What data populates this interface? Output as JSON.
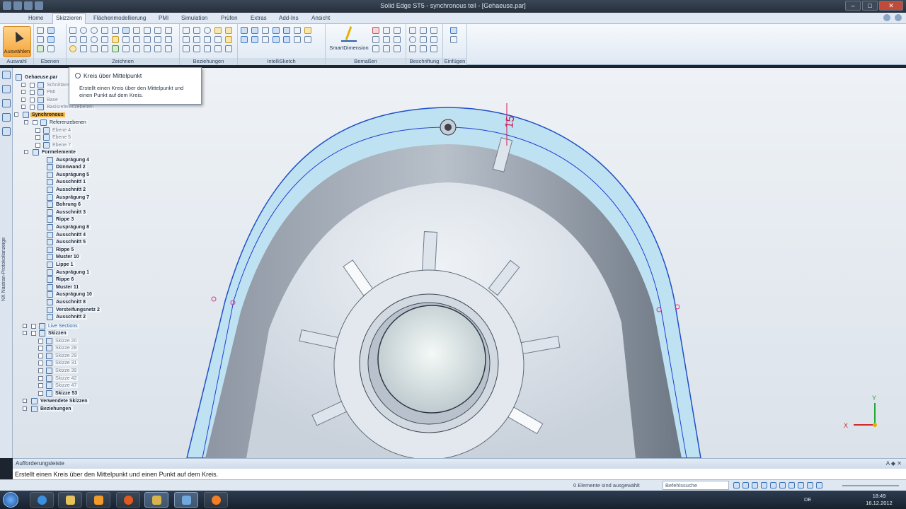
{
  "window": {
    "title": "Solid Edge ST5 - synchronous teil - [Gehaeuse.par]"
  },
  "ribbon": {
    "tabs": [
      "Home",
      "Skizzieren",
      "Flächenmodellierung",
      "PMI",
      "Simulation",
      "Prüfen",
      "Extras",
      "Add-Ins",
      "Ansicht"
    ],
    "active_tab": "Skizzieren",
    "select_label": "Auswählen",
    "smartdimension_label": "SmartDimension",
    "groups": [
      "Auswahl",
      "Ebenen",
      "Zeichnen",
      "Beziehungen",
      "IntelliSketch",
      "Bemaßen",
      "Beschriftung",
      "Einfügen"
    ]
  },
  "tooltip": {
    "title": "Kreis über Mittelpunkt",
    "body": "Erstellt einen Kreis über den Mittelpunkt und einen Punkt auf dem Kreis."
  },
  "leftbar": {
    "vertical_text": "NX Nastran-Protokollanzeige"
  },
  "tree": {
    "root": "Gehaeuse.par",
    "items": [
      {
        "label": "Schnittansichten",
        "style": "dim"
      },
      {
        "label": "PMI",
        "style": "dim"
      },
      {
        "label": "Base",
        "style": "dim"
      },
      {
        "label": "Basisreferenzebenen",
        "style": "dim"
      },
      {
        "label": "Synchronous",
        "style": "hl"
      },
      {
        "label": "Referenzebenen",
        "style": "normal"
      },
      {
        "label": "Ebene 4",
        "style": "dim"
      },
      {
        "label": "Ebene 5",
        "style": "dim"
      },
      {
        "label": "Ebene 7",
        "style": "dim"
      },
      {
        "label": "Formelemente",
        "style": "b"
      },
      {
        "label": "Ausprägung 4",
        "style": "b"
      },
      {
        "label": "Dünnwand 2",
        "style": "b"
      },
      {
        "label": "Ausprägung 5",
        "style": "b"
      },
      {
        "label": "Ausschnitt 1",
        "style": "b"
      },
      {
        "label": "Ausschnitt 2",
        "style": "b"
      },
      {
        "label": "Ausprägung 7",
        "style": "b"
      },
      {
        "label": "Bohrung 6",
        "style": "b"
      },
      {
        "label": "Ausschnitt 3",
        "style": "b"
      },
      {
        "label": "Rippe 3",
        "style": "b"
      },
      {
        "label": "Ausprägung 8",
        "style": "b"
      },
      {
        "label": "Ausschnitt 4",
        "style": "b"
      },
      {
        "label": "Ausschnitt 5",
        "style": "b"
      },
      {
        "label": "Rippe 5",
        "style": "b"
      },
      {
        "label": "Muster 10",
        "style": "b"
      },
      {
        "label": "Lippe 1",
        "style": "b"
      },
      {
        "label": "Ausprägung 1",
        "style": "b"
      },
      {
        "label": "Rippe 6",
        "style": "b"
      },
      {
        "label": "Muster 11",
        "style": "b"
      },
      {
        "label": "Ausprägung 10",
        "style": "b"
      },
      {
        "label": "Ausschnitt 8",
        "style": "b"
      },
      {
        "label": "Versteifungsnetz 2",
        "style": "b"
      },
      {
        "label": "Ausschnitt 2",
        "style": "b"
      },
      {
        "label": "Live Sections",
        "style": "blue"
      },
      {
        "label": "Skizzen",
        "style": "b"
      },
      {
        "label": "Skizze 20",
        "style": "dim"
      },
      {
        "label": "Skizze 28",
        "style": "dim"
      },
      {
        "label": "Skizze 29",
        "style": "dim"
      },
      {
        "label": "Skizze 31",
        "style": "dim"
      },
      {
        "label": "Skizze 39",
        "style": "dim"
      },
      {
        "label": "Skizze 42",
        "style": "dim"
      },
      {
        "label": "Skizze 47",
        "style": "dim"
      },
      {
        "label": "Skizze 53",
        "style": "b"
      },
      {
        "label": "Verwendete Skizzen",
        "style": "b"
      },
      {
        "label": "Beziehungen",
        "style": "b"
      }
    ]
  },
  "viewport": {
    "dimension_value": "15",
    "triad_x": "X",
    "triad_y": "Y"
  },
  "promptbar": {
    "title": "Aufforderungsleiste",
    "text": "Erstellt einen Kreis über den Mittelpunkt und einen Punkt auf dem Kreis.",
    "buttons": "A ◆ ✕"
  },
  "statusbar": {
    "selection_text": "0 Elemente sind ausgewählt",
    "command_search_placeholder": "Befehlssuche"
  },
  "taskbar": {
    "language": "DE",
    "time": "18:49",
    "date": "16.12.2012"
  }
}
